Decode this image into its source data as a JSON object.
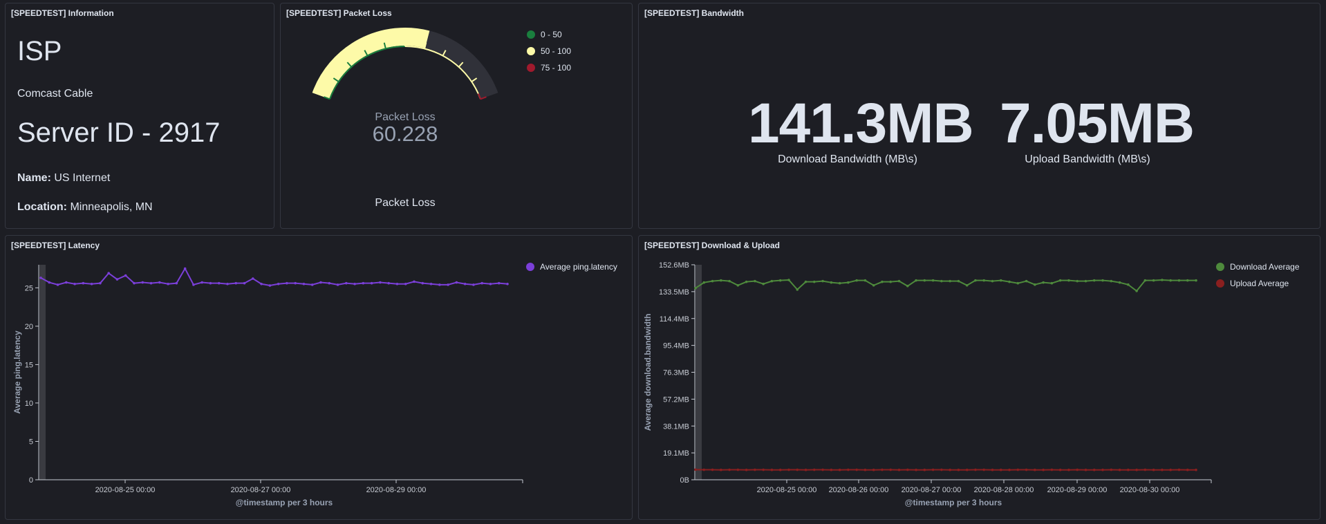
{
  "info": {
    "title": "[SPEEDTEST] Information",
    "isp_heading": "ISP",
    "isp_name": "Comcast Cable",
    "server_heading": "Server ID - 2917",
    "name_label": "Name:",
    "name_value": "US Internet",
    "location_label": "Location:",
    "location_value": "Minneapolis, MN"
  },
  "packet_loss": {
    "title": "[SPEEDTEST] Packet Loss",
    "gauge_label": "Packet Loss",
    "gauge_value": "60.228",
    "value": 60.228,
    "max": 100,
    "footer_label": "Packet Loss",
    "fill_color": "#fdfaa8",
    "legend": [
      {
        "label": "0 - 50",
        "color": "#1a7f3e"
      },
      {
        "label": "50 - 100",
        "color": "#fdfaa8"
      },
      {
        "label": "75 - 100",
        "color": "#a01a2d"
      }
    ]
  },
  "bandwidth": {
    "title": "[SPEEDTEST] Bandwidth",
    "download_value": "141.3MB",
    "download_label": "Download Bandwidth (MB\\s)",
    "upload_value": "7.05MB",
    "upload_label": "Upload Bandwidth (MB\\s)"
  },
  "latency": {
    "title": "[SPEEDTEST] Latency",
    "legend_label": "Average ping.latency",
    "legend_color": "#7b3fd9",
    "chart_data": {
      "type": "line",
      "title": "",
      "xlabel": "@timestamp per 3 hours",
      "ylabel": "Average ping.latency",
      "ylim": [
        0,
        28
      ],
      "yticks": [
        0,
        5,
        10,
        15,
        20,
        25
      ],
      "xticks": [
        "2020-08-25 00:00",
        "2020-08-27 00:00",
        "2020-08-29 00:00"
      ],
      "grid": false,
      "legend_position": "top-right",
      "series": [
        {
          "name": "Average ping.latency",
          "color": "#7b3fd9",
          "values": [
            26.3,
            25.7,
            25.4,
            25.7,
            25.5,
            25.6,
            25.5,
            25.6,
            26.9,
            26.1,
            26.6,
            25.6,
            25.7,
            25.6,
            25.7,
            25.5,
            25.6,
            27.5,
            25.4,
            25.7,
            25.6,
            25.6,
            25.5,
            25.6,
            25.6,
            26.2,
            25.5,
            25.3,
            25.5,
            25.6,
            25.6,
            25.5,
            25.4,
            25.7,
            25.6,
            25.4,
            25.6,
            25.5,
            25.6,
            25.6,
            25.7,
            25.6,
            25.5,
            25.5,
            25.8,
            25.6,
            25.5,
            25.4,
            25.4,
            25.7,
            25.5,
            25.4,
            25.6,
            25.5,
            25.6,
            25.5
          ]
        }
      ]
    }
  },
  "download_upload": {
    "title": "[SPEEDTEST] Download & Upload",
    "chart_data": {
      "type": "line",
      "title": "",
      "xlabel": "@timestamp per 3 hours",
      "ylabel": "Average download.bandwidth",
      "ylim": [
        0,
        152.6
      ],
      "yticks": [
        "0B",
        "19.1MB",
        "38.1MB",
        "57.2MB",
        "76.3MB",
        "95.4MB",
        "114.4MB",
        "133.5MB",
        "152.6MB"
      ],
      "xticks": [
        "2020-08-25 00:00",
        "2020-08-26 00:00",
        "2020-08-27 00:00",
        "2020-08-28 00:00",
        "2020-08-29 00:00",
        "2020-08-30 00:00"
      ],
      "grid": false,
      "legend_position": "top-right",
      "series": [
        {
          "name": "Download Average",
          "color": "#4e8a3c",
          "values": [
            136,
            140,
            141,
            141.5,
            141,
            138,
            140.5,
            141,
            139,
            141,
            141.5,
            141.8,
            135,
            140.5,
            140.5,
            141,
            140,
            139.5,
            140,
            141.5,
            141.5,
            138,
            140.5,
            140.5,
            141,
            137.5,
            141.5,
            141.5,
            141.5,
            141,
            141,
            141,
            138,
            141.5,
            141.5,
            141,
            141.5,
            140.5,
            139.5,
            141,
            138.5,
            140,
            139.5,
            141.5,
            141.5,
            141,
            141,
            141.5,
            141.5,
            141,
            140,
            138.5,
            134,
            141.5,
            141.5,
            141.8,
            141.5,
            141.5,
            141.5,
            141.5
          ]
        },
        {
          "name": "Upload Average",
          "color": "#8a1f1f",
          "values": [
            7.2,
            7.1,
            7.1,
            7.0,
            7.1,
            7.1,
            7.0,
            7.1,
            7.1,
            7.0,
            7.0,
            7.1,
            7.1,
            7.0,
            7.1,
            7.1,
            7.0,
            7.0,
            7.1,
            7.1,
            7.0,
            7.0,
            7.1,
            7.1,
            7.0,
            7.1,
            7.0,
            7.0,
            7.1,
            7.1,
            7.0,
            7.0,
            7.0,
            7.1,
            7.1,
            7.0,
            7.0,
            7.0,
            7.1,
            7.1,
            7.0,
            7.0,
            7.1,
            7.0,
            7.0,
            7.1,
            7.0,
            7.0,
            7.0,
            7.1,
            7.0,
            7.0,
            7.0,
            7.1,
            7.0,
            7.0,
            7.0,
            7.1,
            7.0,
            7.0
          ]
        }
      ]
    }
  }
}
